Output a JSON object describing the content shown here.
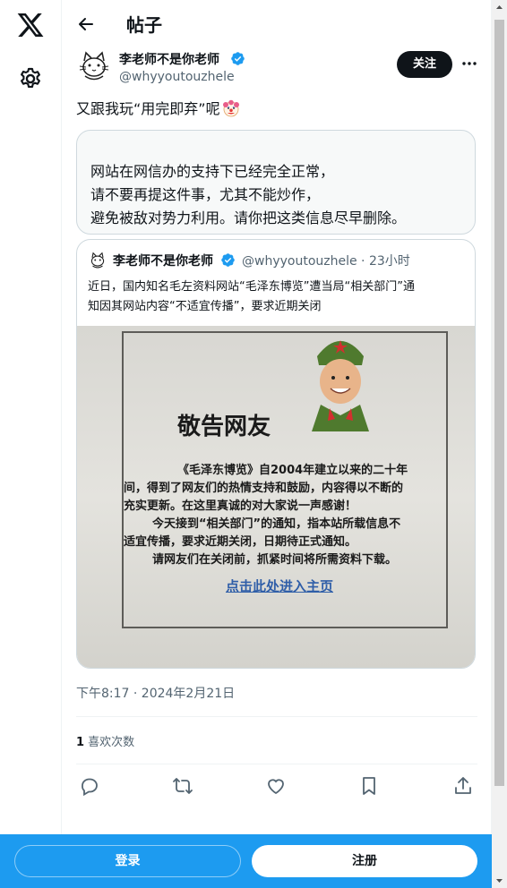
{
  "header": {
    "title": "帖子"
  },
  "author": {
    "name": "李老师不是你老师",
    "handle": "@whyyoutouzhele",
    "follow_label": "关注"
  },
  "tweet": {
    "text": "又跟我玩“用完即弃”呢"
  },
  "notice_card": {
    "lines": [
      "网站在网信办的支持下已经完全正常，",
      "请不要再提这件事，尤其不能炒作，",
      "避免被敌对势力利用。请你把这类信息尽早删除。"
    ]
  },
  "quoted_tweet": {
    "name": "李老师不是你老师",
    "meta": "@whyyoutouzhele · 23小时",
    "text_lines": [
      "近日，国内知名毛左资料网站“毛泽东博览”遭当局“相关部门”通",
      "知因其网站内容“不适宜传播”，要求近期关闭"
    ],
    "image": {
      "title": "敬告网友",
      "body_lines": [
        "《毛泽东博览》自2004年建立以来的二十年",
        "间，得到了网友们的热情支持和鼓励，内容得以不断的",
        "充实更新。在这里真诚的对大家说一声感谢！",
        "今天接到“相关部门”的通知，指本站所载信息不",
        "适宜传播，要求近期关闭，日期待正式通知。",
        "请网友们在关闭前，抓紧时间将所需资料下载。"
      ],
      "link_text": "点击此处进入主页"
    }
  },
  "timestamp": "下午8:17 · 2024年2月21日",
  "stats": {
    "likes_count": "1",
    "likes_label": " 喜欢次数"
  },
  "bottom_bar": {
    "login_label": "登录",
    "signup_label": "注册"
  },
  "colors": {
    "accent": "#1d9bf0",
    "verified": "#1d9bf0",
    "text": "#0f1419",
    "secondary": "#536471"
  },
  "icons": [
    "x-logo-icon",
    "gear-icon",
    "back-arrow-icon",
    "verified-icon",
    "more-icon",
    "clown-emoji-icon",
    "reply-icon",
    "retweet-icon",
    "like-icon",
    "bookmark-icon",
    "share-icon"
  ]
}
